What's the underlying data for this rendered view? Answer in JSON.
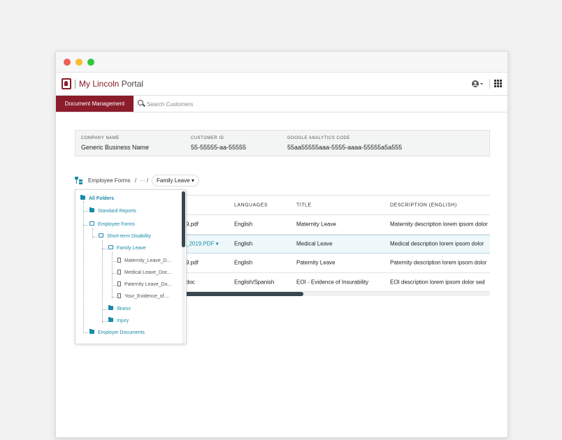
{
  "app": {
    "brand_name": "My Lincoln",
    "brand_suffix": " Portal",
    "brand_color": "#8a1c2c",
    "accent_color": "#1a8aa7"
  },
  "subnav": {
    "tab_label": "Document Management",
    "search_placeholder": "Search Customers"
  },
  "company": {
    "name_label": "COMPANY NAME",
    "name_value": "Generic Business Name",
    "id_label": "CUSTOMER ID",
    "id_value": "55-55555-aa-55555",
    "ga_label": "GOOGLE ANALYTICS CODE",
    "ga_value": "55aa55555aaa-5555-aaaa-55555a5a555"
  },
  "breadcrumb": {
    "root": "Employee Forms",
    "sep1": "/",
    "ellipsis": "···",
    "sep2": "/",
    "current": "Family Leave"
  },
  "table": {
    "headers": [
      "",
      "LANGUAGES",
      "TITLE",
      "DESCRIPTION (ENGLISH)"
    ],
    "rows": [
      {
        "file": "9.pdf",
        "language": "English",
        "title": "Maternity Leave",
        "description": "Maternity description lorem ipsom dolor"
      },
      {
        "file": "_2019.PDF",
        "language": "English",
        "title": "Medical Leave",
        "description": "Medical description lorem ipsom dolor"
      },
      {
        "file": "9.pdf",
        "language": "English",
        "title": "Paternity Leave",
        "description": "Paternity description lorem ipsom dolor"
      },
      {
        "file": "doc",
        "language": "English/Spanish",
        "title": "EOI - Evidence of Insurability",
        "description": "EOI description lorem ipsom dolor sed"
      }
    ]
  },
  "tree": {
    "all_folders": "All Folders",
    "standard_reports": "Standard Reports",
    "employee_forms": "Employee Forms",
    "short_term_disability": "Short-term Disability",
    "family_leave": "Family Leave",
    "files": [
      "Maternity_Leave_D...",
      "Medical Leave_Doc...",
      "Paternity Leave_Do...",
      "Your_Evidence_of...."
    ],
    "illness": "Illness",
    "injury": "Injury",
    "employer_documents": "Employer Documents"
  },
  "icons": {
    "logo": "lincoln-logo-icon",
    "user": "user-icon",
    "apps": "grid-icon",
    "search": "search-icon",
    "tree": "tree-icon",
    "folder": "folder-icon",
    "document": "document-icon"
  }
}
